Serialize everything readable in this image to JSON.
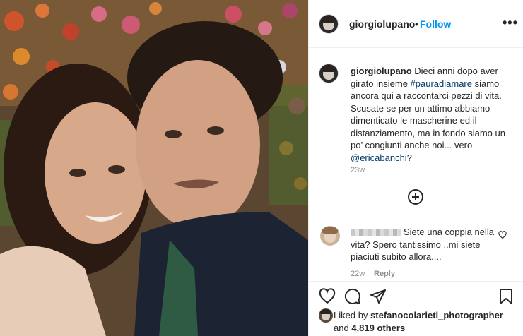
{
  "post": {
    "header": {
      "username": "giorgiolupano",
      "separator": "•",
      "follow_label": "Follow",
      "more_icon": "more-horizontal-icon"
    },
    "caption": {
      "username": "giorgiolupano",
      "text_before": "Dieci anni dopo aver girato insieme ",
      "hashtag": "#pauradiamare",
      "text_after": " siamo ancora qui a raccontarci pezzi di vita. Scusate se per un attimo abbiamo dimenticato le mascherine ed il distanziamento, ma in fondo siamo un po’ congiunti anche noi... vero ",
      "mention": "@ericabanchi",
      "text_end": "?",
      "time": "23w"
    },
    "load_more_icon": "plus-circle-icon",
    "comment": {
      "text": "Siete una coppia nella vita? Spero tantissimo ..mi siete piaciuti subito allora....",
      "time": "22w",
      "reply_label": "Reply",
      "heart_icon": "heart-outline-icon"
    },
    "actions": {
      "like_icon": "heart-icon",
      "comment_icon": "comment-icon",
      "share_icon": "send-icon",
      "save_icon": "bookmark-icon"
    },
    "likes": {
      "prefix": "Liked by ",
      "user": "stefanocolarieti_photographer",
      "middle": "and ",
      "others": "4,819 others"
    }
  },
  "colors": {
    "link_blue": "#0095f6",
    "hashtag": "#00376b",
    "secondary_text": "#8e8e8e",
    "border": "#efefef"
  }
}
